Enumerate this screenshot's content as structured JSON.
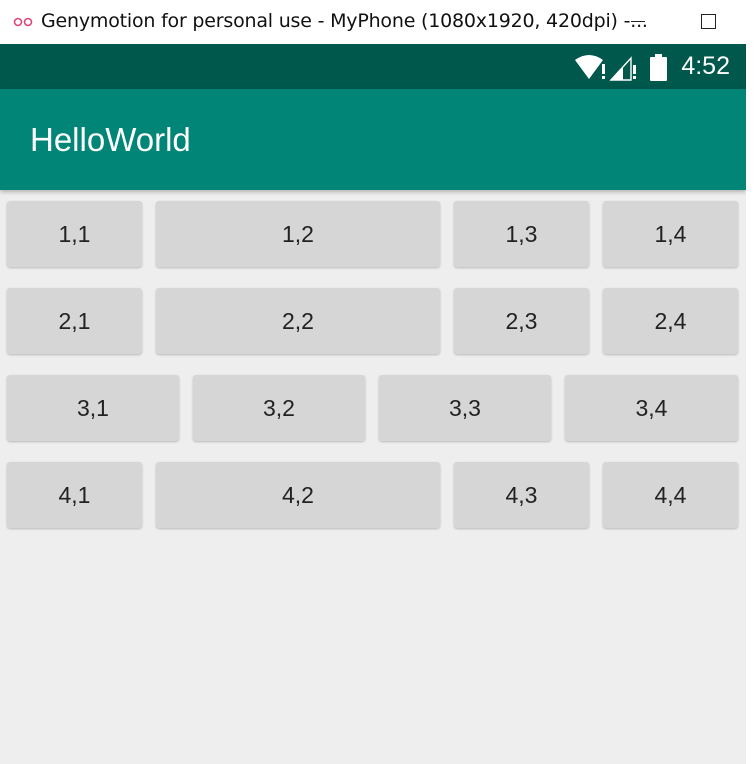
{
  "window": {
    "title": "Genymotion for personal use - MyPhone (1080x1920, 420dpi) -...",
    "logo_icon": "genymotion-logo-icon",
    "controls": [
      "minimize-icon",
      "maximize-icon"
    ]
  },
  "statusbar": {
    "time": "4:52",
    "icons": [
      "wifi-icon",
      "cell-signal-icon",
      "battery-icon"
    ],
    "color": "#00574b"
  },
  "appbar": {
    "title": "HelloWorld",
    "color": "#008577"
  },
  "grid": {
    "rows": [
      [
        "1,1",
        "1,2",
        "1,3",
        "1,4"
      ],
      [
        "2,1",
        "2,2",
        "2,3",
        "2,4"
      ],
      [
        "3,1",
        "3,2",
        "3,3",
        "3,4"
      ],
      [
        "4,1",
        "4,2",
        "4,3",
        "4,4"
      ]
    ]
  }
}
